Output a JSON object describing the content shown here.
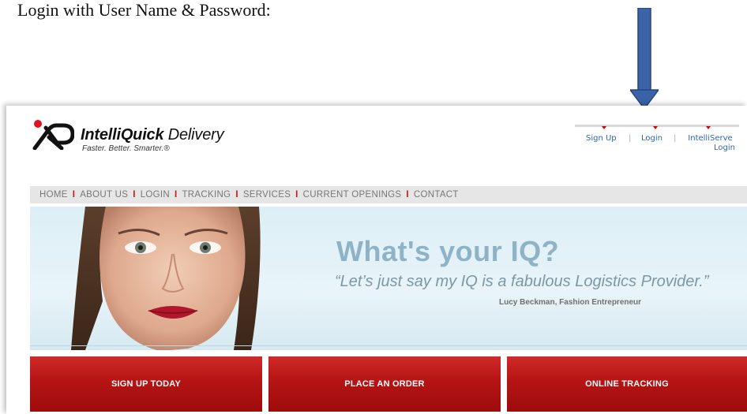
{
  "caption": "Login with User Name & Password:",
  "brand": {
    "name_bold": "IntelliQuick",
    "name_rest": " Delivery",
    "tagline": "Faster. Better. Smarter.®"
  },
  "util_nav": {
    "signup": "Sign Up",
    "login": "Login",
    "intelliserve_line1": "IntelliServe",
    "intelliserve_line2": "Login",
    "separator": "|"
  },
  "main_nav": {
    "items": [
      "HOME",
      "ABOUT US",
      "LOGIN",
      "TRACKING",
      "SERVICES",
      "CURRENT OPENINGS",
      "CONTACT"
    ],
    "separator": "I"
  },
  "hero": {
    "title": "What's your IQ?",
    "quote": "“Let’s just say my IQ is a fabulous Logistics Provider.”",
    "attribution": "Lucy Beckman, Fashion Entrepreneur"
  },
  "cta": {
    "signup": "SIGN UP TODAY",
    "order": "PLACE AN ORDER",
    "tracking": "ONLINE TRACKING"
  },
  "colors": {
    "accent_red": "#b51414",
    "link_blue": "#2e63b8",
    "arrow_blue": "#3a63a8"
  }
}
